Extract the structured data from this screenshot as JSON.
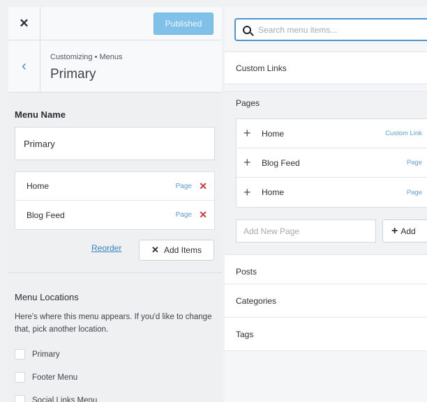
{
  "topbar": {
    "close_glyph": "✕",
    "publish_label": "Published"
  },
  "header": {
    "back_glyph": "‹",
    "breadcrumb": "Customizing • Menus",
    "title": "Primary"
  },
  "menu": {
    "name_label": "Menu Name",
    "name_value": "Primary",
    "items": [
      {
        "label": "Home",
        "type": "Page",
        "remove": "✕"
      },
      {
        "label": "Blog Feed",
        "type": "Page",
        "remove": "✕"
      }
    ],
    "reorder_label": "Reorder",
    "add_items_icon": "✕",
    "add_items_label": "Add Items"
  },
  "locations": {
    "label": "Menu Locations",
    "description": "Here's where this menu appears. If you'd like to change that, pick another location.",
    "options": [
      "Primary",
      "Footer Menu",
      "Social Links Menu"
    ]
  },
  "right": {
    "search_placeholder": "Search menu items...",
    "custom_links_label": "Custom Links",
    "pages_label": "Pages",
    "pages": [
      {
        "label": "Home",
        "type": "Custom Link"
      },
      {
        "label": "Blog Feed",
        "type": "Page"
      },
      {
        "label": "Home",
        "type": "Page"
      }
    ],
    "plus_glyph": "+",
    "add_page_placeholder": "Add New Page",
    "add_button_label": "Add",
    "posts_label": "Posts",
    "categories_label": "Categories",
    "tags_label": "Tags"
  },
  "colors": {
    "accent": "#3582c4",
    "publish": "#7fc1e8",
    "remove": "#d63638"
  }
}
